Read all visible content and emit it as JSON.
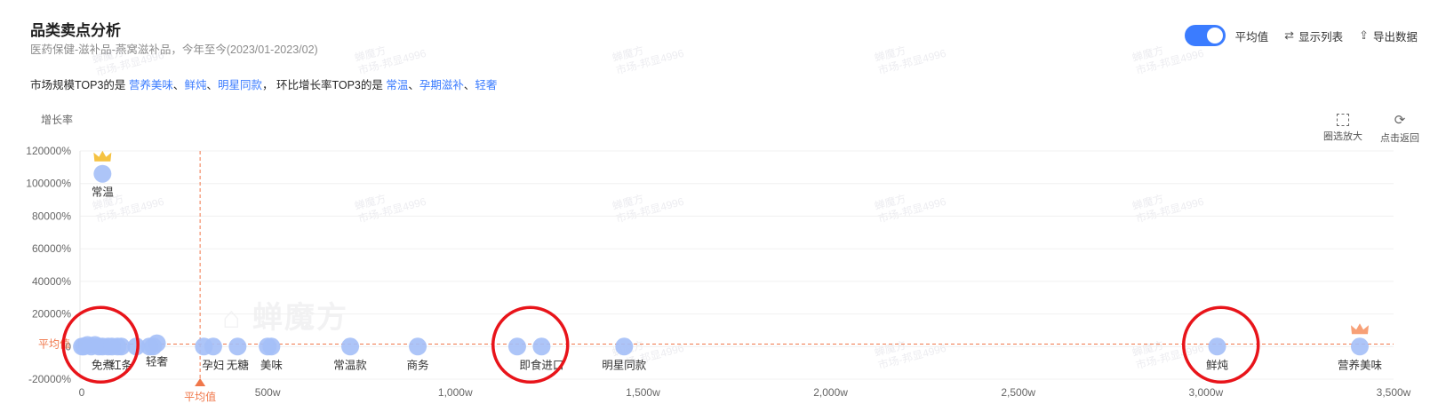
{
  "header": {
    "title": "品类卖点分析",
    "subtitle": "医药保健-滋补品-燕窝滋补品，今年至今(2023/01-2023/02)"
  },
  "summary": {
    "prefix": "市场规模TOP3的是 ",
    "market_top3": [
      "营养美味",
      "鲜炖",
      "明星同款"
    ],
    "middle": "， 环比增长率TOP3的是 ",
    "growth_top3": [
      "常温",
      "孕期滋补",
      "轻奢"
    ],
    "sep": "、"
  },
  "toolbar": {
    "avg_toggle_label": "平均值",
    "avg_toggle_on": true,
    "show_list_label": "显示列表",
    "export_label": "导出数据"
  },
  "zoom_tools": {
    "select_zoom_label": "圈选放大",
    "reset_label": "点击返回"
  },
  "watermark": {
    "brand": "蝉魔方",
    "line1": "蝉魔方",
    "line2": "市场-邦显4996"
  },
  "chart_data": {
    "type": "scatter",
    "ylabel": "增长率",
    "xlabel": "",
    "ylim": [
      -20000,
      120000
    ],
    "xlim": [
      0,
      3500
    ],
    "y_ticks": [
      "-20000%",
      "0",
      "20000%",
      "40000%",
      "60000%",
      "80000%",
      "100000%",
      "120000%"
    ],
    "y_tick_values": [
      -20000,
      0,
      20000,
      40000,
      60000,
      80000,
      100000,
      120000
    ],
    "x_ticks": [
      "0",
      "500w",
      "1,000w",
      "1,500w",
      "2,000w",
      "2,500w",
      "3,000w",
      "3,500w"
    ],
    "x_tick_values": [
      0,
      500,
      1000,
      1500,
      2000,
      2500,
      3000,
      3500
    ],
    "avg_line": {
      "x": 320,
      "y": 1500,
      "label": "平均值",
      "color": "#f0774a"
    },
    "point_color": "#a4bff7",
    "crown_gold": "#f5c242",
    "crown_orange": "#f7a077",
    "points": [
      {
        "name": "常温",
        "x": 60,
        "y": 106000,
        "crown": "gold"
      },
      {
        "name": "营养美味",
        "x": 3410,
        "y": 0,
        "crown": "orange"
      },
      {
        "name": "鲜炖",
        "x": 3030,
        "y": 0
      },
      {
        "name": "明星同款",
        "x": 1450,
        "y": 0
      },
      {
        "name": "即食进口",
        "x": 1230,
        "y": 0
      },
      {
        "name": "",
        "x": 1165,
        "y": 0
      },
      {
        "name": "商务",
        "x": 900,
        "y": 0
      },
      {
        "name": "常温款",
        "x": 720,
        "y": 0
      },
      {
        "name": "美味",
        "x": 510,
        "y": 0
      },
      {
        "name": "",
        "x": 500,
        "y": 0
      },
      {
        "name": "无糖",
        "x": 420,
        "y": 0
      },
      {
        "name": "孕妇",
        "x": 355,
        "y": 0
      },
      {
        "name": "",
        "x": 330,
        "y": 0
      },
      {
        "name": "轻奢",
        "x": 205,
        "y": 2000
      },
      {
        "name": "",
        "x": 195,
        "y": 0
      },
      {
        "name": "",
        "x": 185,
        "y": 0
      },
      {
        "name": "",
        "x": 150,
        "y": 0
      },
      {
        "name": "红条",
        "x": 110,
        "y": 0
      },
      {
        "name": "",
        "x": 100,
        "y": 0
      },
      {
        "name": "免煮",
        "x": 60,
        "y": 0
      },
      {
        "name": "",
        "x": 75,
        "y": 0
      },
      {
        "name": "",
        "x": 85,
        "y": 0
      },
      {
        "name": "",
        "x": 50,
        "y": 0
      },
      {
        "name": "",
        "x": 40,
        "y": 1000
      },
      {
        "name": "",
        "x": 30,
        "y": 0
      },
      {
        "name": "",
        "x": 20,
        "y": 1000
      },
      {
        "name": "",
        "x": 10,
        "y": 0
      },
      {
        "name": "",
        "x": 5,
        "y": 0
      }
    ],
    "highlight_circles": [
      {
        "x": 55,
        "y": 0,
        "color": "#e8141a"
      },
      {
        "x": 1200,
        "y": 0,
        "color": "#e8141a"
      },
      {
        "x": 3040,
        "y": 0,
        "color": "#e8141a"
      }
    ]
  }
}
